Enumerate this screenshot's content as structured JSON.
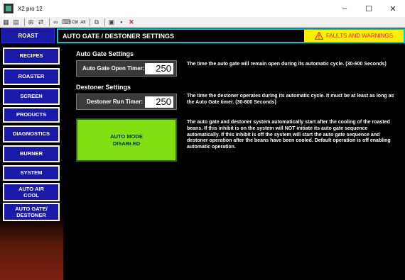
{
  "window": {
    "title": "X2 pro 12",
    "minimize": "–",
    "maximize": "☐",
    "close": "✕"
  },
  "toolbar": {
    "ctrl_label": "Ctrl",
    "alt_label": "Alt"
  },
  "header": {
    "section_tab": "ROAST",
    "page_title": "AUTO GATE / DESTONER SETTINGS",
    "faults_label": "FAULTS AND WARNINGS"
  },
  "sidebar": {
    "items": [
      {
        "label": "RECIPES"
      },
      {
        "label": "ROASTER"
      },
      {
        "label": "SCREEN"
      },
      {
        "label": "PRODUCTS"
      },
      {
        "label": "DIAGNOSTICS"
      },
      {
        "label": "BURNER"
      },
      {
        "label": "SYSTEM"
      },
      {
        "label": "AUTO AIR COOL"
      },
      {
        "label": "AUTO GATE/ DESTONER"
      }
    ]
  },
  "auto_gate": {
    "section_title": "Auto Gate Settings",
    "timer_label": "Auto Gate Open Timer:",
    "timer_value": "250",
    "description": "The time the auto gate will remain open during its automatic cycle. (30-600 Seconds)"
  },
  "destoner": {
    "section_title": "Destoner Settings",
    "timer_label": "Destoner Run Timer:",
    "timer_value": "250",
    "description": "The time the destoner operates during its automatic cycle. It must be at least as long as the Auto Gate timer. (30-600 Seconds)"
  },
  "auto_mode": {
    "line1": "AUTO MODE",
    "line2": "DISABLED",
    "description": "The auto gate and destoner system automatically start after the cooling of the roasted beans. If this inhibit is on the system will NOT initiate its auto gate sequence automatically. If this inhibit is off the system will start the auto gate sequence and destoner operation after the beans have been cooled. Default operation is off enabling automatic operation."
  },
  "colors": {
    "nav_button": "#1a1aaa",
    "header_border": "#00c8d8",
    "faults_bg": "#ffee00",
    "auto_mode_bg": "#80e012"
  }
}
